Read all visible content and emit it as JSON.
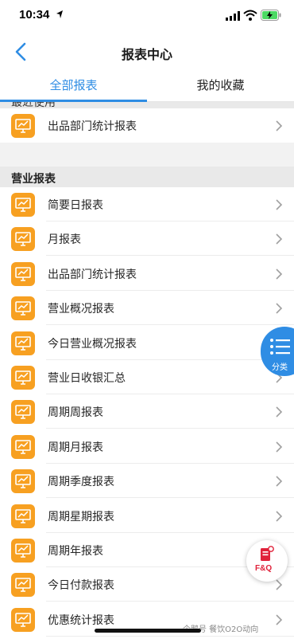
{
  "status_bar": {
    "time": "10:34"
  },
  "nav": {
    "title": "报表中心"
  },
  "tabs": [
    {
      "label": "全部报表",
      "active": true
    },
    {
      "label": "我的收藏",
      "active": false
    }
  ],
  "recent_section": {
    "title": "最近使用",
    "items": [
      {
        "label": "出品部门统计报表"
      }
    ]
  },
  "business_section": {
    "title": "营业报表",
    "items": [
      {
        "label": "简要日报表"
      },
      {
        "label": "月报表"
      },
      {
        "label": "出品部门统计报表"
      },
      {
        "label": "营业概况报表"
      },
      {
        "label": "今日营业概况报表"
      },
      {
        "label": "营业日收银汇总"
      },
      {
        "label": "周期周报表"
      },
      {
        "label": "周期月报表"
      },
      {
        "label": "周期季度报表"
      },
      {
        "label": "周期星期报表"
      },
      {
        "label": "周期年报表"
      },
      {
        "label": "今日付款报表"
      },
      {
        "label": "优惠统计报表"
      }
    ]
  },
  "fab_category": {
    "label": "分类"
  },
  "fab_faq": {
    "label": "F&Q"
  },
  "watermark": {
    "text": "企鹅号 餐饮O2O动向"
  },
  "colors": {
    "accent": "#2f8de4",
    "icon_bg": "#f7a021",
    "faq_red": "#e0213a"
  }
}
